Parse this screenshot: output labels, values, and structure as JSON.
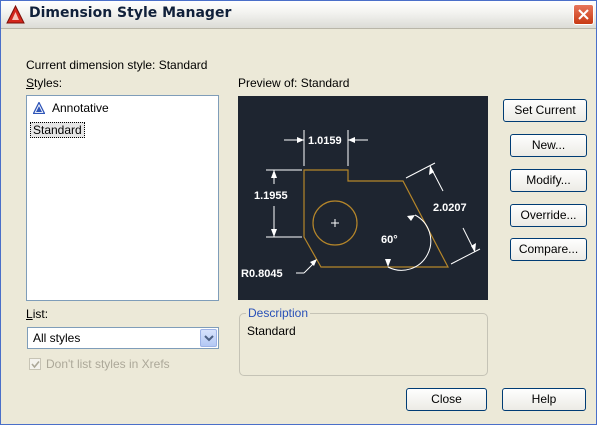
{
  "window": {
    "title": "Dimension Style Manager"
  },
  "current_style": {
    "text": "Current dimension style: Standard"
  },
  "styles": {
    "label": "Styles:",
    "items": [
      {
        "label": "Annotative",
        "icon": "annotative-icon"
      },
      {
        "label": "Standard",
        "selected": true
      }
    ]
  },
  "preview": {
    "label": "Preview of: Standard",
    "dimensions": {
      "top_width": "1.0159",
      "left_height": "1.1955",
      "slant_length": "2.0207",
      "angle": "60°",
      "radius": "R0.8045"
    },
    "colors": {
      "background": "#1e2530",
      "geometry": "#b5862a",
      "dimension": "#ffffff"
    }
  },
  "buttons": {
    "set_current": "Set Current",
    "new": "New...",
    "modify": "Modify...",
    "override": "Override...",
    "compare": "Compare...",
    "close": "Close",
    "help": "Help"
  },
  "list": {
    "label": "List:",
    "value": "All styles",
    "checkbox_label": "Don't list styles in Xrefs",
    "checkbox_checked": true,
    "checkbox_disabled": true
  },
  "description": {
    "legend": "Description",
    "text": "Standard"
  }
}
